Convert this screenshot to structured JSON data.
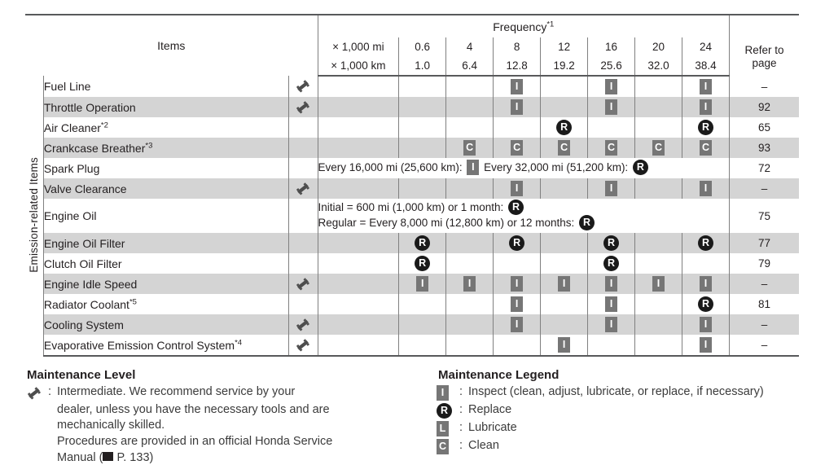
{
  "table": {
    "items_header": "Items",
    "frequency_header": "Frequency",
    "frequency_footnote": "*1",
    "unit_mi": "× 1,000 mi",
    "unit_km": "× 1,000 km",
    "refer_to_page": "Refer to\npage",
    "refer_line1": "Refer to",
    "refer_line2": "page",
    "vertical_label": "Emission-related Items",
    "freq_mi": [
      "0.6",
      "4",
      "8",
      "12",
      "16",
      "20",
      "24"
    ],
    "freq_km": [
      "1.0",
      "6.4",
      "12.8",
      "19.2",
      "25.6",
      "32.0",
      "38.4"
    ],
    "rows": [
      {
        "name": "Fuel Line",
        "footnote": "",
        "wrench": true,
        "shaded": false,
        "marks": [
          "",
          "",
          "I",
          "",
          "I",
          "",
          "I"
        ],
        "page": "–",
        "span": null
      },
      {
        "name": "Throttle Operation",
        "footnote": "",
        "wrench": true,
        "shaded": true,
        "marks": [
          "",
          "",
          "I",
          "",
          "I",
          "",
          "I"
        ],
        "page": "92",
        "span": null
      },
      {
        "name": "Air Cleaner",
        "footnote": "*2",
        "wrench": false,
        "shaded": false,
        "marks": [
          "",
          "",
          "",
          "R",
          "",
          "",
          "R"
        ],
        "page": "65",
        "span": null
      },
      {
        "name": "Crankcase Breather",
        "footnote": "*3",
        "wrench": false,
        "shaded": true,
        "marks": [
          "",
          "C",
          "C",
          "C",
          "C",
          "C",
          "C"
        ],
        "page": "93",
        "span": null
      },
      {
        "name": "Spark Plug",
        "footnote": "",
        "wrench": false,
        "shaded": false,
        "marks": [],
        "page": "72",
        "span": {
          "lines": [
            [
              {
                "t": "text",
                "v": "Every 16,000 mi (25,600 km): "
              },
              {
                "t": "mark",
                "v": "I"
              },
              {
                "t": "text",
                "v": " Every 32,000 mi (51,200 km): "
              },
              {
                "t": "mark",
                "v": "R"
              }
            ]
          ]
        }
      },
      {
        "name": "Valve Clearance",
        "footnote": "",
        "wrench": true,
        "shaded": true,
        "marks": [
          "",
          "",
          "I",
          "",
          "I",
          "",
          "I"
        ],
        "page": "–",
        "span": null
      },
      {
        "name": "Engine Oil",
        "footnote": "",
        "wrench": false,
        "shaded": false,
        "marks": [],
        "page": "75",
        "span": {
          "lines": [
            [
              {
                "t": "text",
                "v": "Initial = 600 mi (1,000 km) or 1 month: "
              },
              {
                "t": "mark",
                "v": "R"
              }
            ],
            [
              {
                "t": "text",
                "v": "Regular = Every 8,000 mi (12,800 km) or 12 months: "
              },
              {
                "t": "mark",
                "v": "R"
              }
            ]
          ]
        }
      },
      {
        "name": "Engine Oil Filter",
        "footnote": "",
        "wrench": false,
        "shaded": true,
        "marks": [
          "R",
          "",
          "R",
          "",
          "R",
          "",
          "R"
        ],
        "page": "77",
        "span": null
      },
      {
        "name": "Clutch Oil Filter",
        "footnote": "",
        "wrench": false,
        "shaded": false,
        "marks": [
          "R",
          "",
          "",
          "",
          "R",
          "",
          ""
        ],
        "page": "79",
        "span": null
      },
      {
        "name": "Engine Idle Speed",
        "footnote": "",
        "wrench": true,
        "shaded": true,
        "marks": [
          "I",
          "I",
          "I",
          "I",
          "I",
          "I",
          "I"
        ],
        "page": "–",
        "span": null
      },
      {
        "name": "Radiator Coolant",
        "footnote": "*5",
        "wrench": false,
        "shaded": false,
        "marks": [
          "",
          "",
          "I",
          "",
          "I",
          "",
          "R"
        ],
        "page": "81",
        "span": null
      },
      {
        "name": "Cooling System",
        "footnote": "",
        "wrench": true,
        "shaded": true,
        "marks": [
          "",
          "",
          "I",
          "",
          "I",
          "",
          "I"
        ],
        "page": "–",
        "span": null
      },
      {
        "name": "Evaporative Emission Control System",
        "footnote": "*4",
        "wrench": true,
        "shaded": false,
        "marks": [
          "",
          "",
          "",
          "I",
          "",
          "",
          "I"
        ],
        "page": "–",
        "span": null
      }
    ]
  },
  "maintenance_level": {
    "title": "Maintenance Level",
    "icon": "wrench-icon",
    "colon": ":",
    "lines": [
      "Intermediate. We recommend service by your",
      "dealer, unless you have the necessary tools and are",
      "mechanically skilled.",
      "Procedures are provided in an official Honda Service",
      "Manual ( P. 133)"
    ]
  },
  "maintenance_legend": {
    "title": "Maintenance Legend",
    "entries": [
      {
        "mark": "I",
        "style": "square",
        "colon": ":",
        "text": "Inspect (clean, adjust, lubricate, or replace, if necessary)"
      },
      {
        "mark": "R",
        "style": "circle",
        "colon": ":",
        "text": "Replace"
      },
      {
        "mark": "L",
        "style": "square",
        "colon": ":",
        "text": "Lubricate"
      },
      {
        "mark": "C",
        "style": "square",
        "colon": ":",
        "text": "Clean"
      }
    ]
  },
  "colors": {
    "shade_row": "#d4d4d4",
    "badge_gray": "#767676",
    "badge_black": "#1a1a1a",
    "rule": "#58595b",
    "grid": "#808080"
  }
}
